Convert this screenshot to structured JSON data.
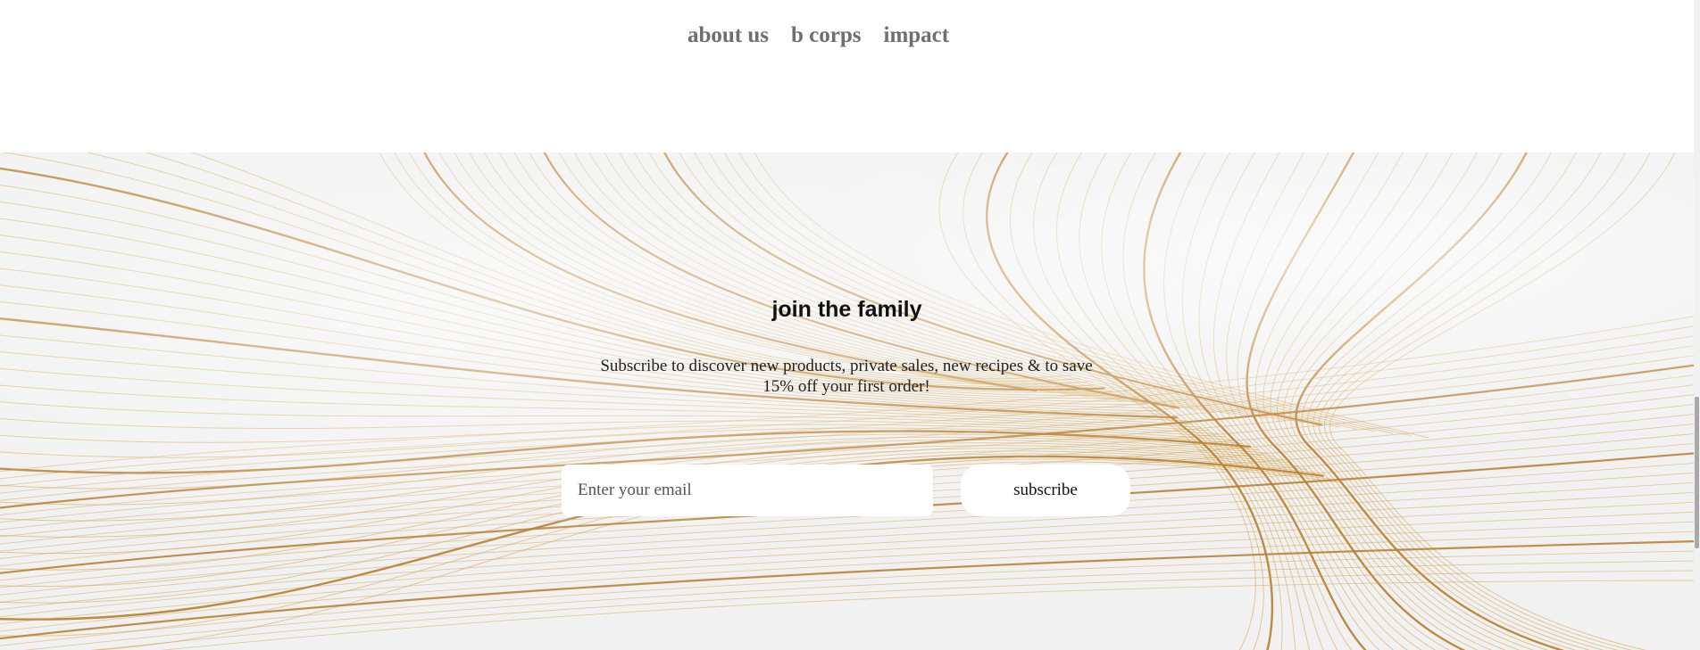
{
  "nav": {
    "links": [
      {
        "label": "about us"
      },
      {
        "label": "b corps"
      },
      {
        "label": "impact"
      }
    ]
  },
  "newsletter": {
    "title": "join the family",
    "text": "Subscribe to discover new products, private sales, new recipes & to save 15% off your first order!",
    "email_placeholder": "Enter your email",
    "email_value": "",
    "subscribe_label": "subscribe"
  },
  "colors": {
    "nav_text": "#6f6f6f",
    "band_bg": "#f1f1f1",
    "gold_line": "#d4a24c",
    "gold_dark": "#b87d2c"
  },
  "icons": {
    "background": "gold-line-wave-art"
  }
}
